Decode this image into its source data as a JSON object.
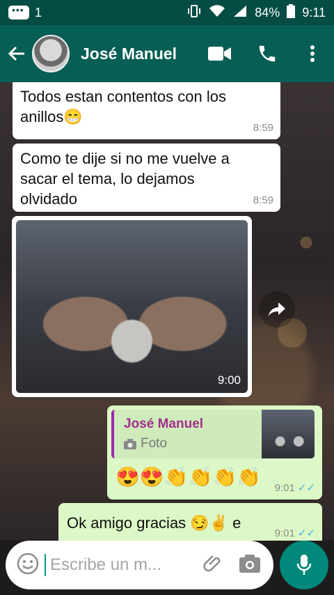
{
  "status": {
    "notification_count": "1",
    "battery": "84%",
    "time": "9:11"
  },
  "header": {
    "contact_name": "José Manuel"
  },
  "messages": [
    {
      "direction": "in",
      "text": "Todos estan contentos con los anillos😁",
      "time": "8:59"
    },
    {
      "direction": "in",
      "text": "Como te dije si no me vuelve a sacar el tema, lo dejamos olvidado",
      "time": "8:59"
    },
    {
      "direction": "in",
      "type": "photo",
      "time": "9:00"
    },
    {
      "direction": "out",
      "quote": {
        "name": "José Manuel",
        "label": "Foto"
      },
      "text": "😍😍👏👏👏👏",
      "time": "9:01"
    },
    {
      "direction": "out",
      "text": "Ok amigo gracias 😏✌ e",
      "time": "9:01"
    }
  ],
  "input": {
    "placeholder": "Escribe un m..."
  },
  "colors": {
    "header": "#075e54",
    "status_bar": "#054d44",
    "outgoing_bubble": "#dcf8c6",
    "fab": "#00897b"
  }
}
